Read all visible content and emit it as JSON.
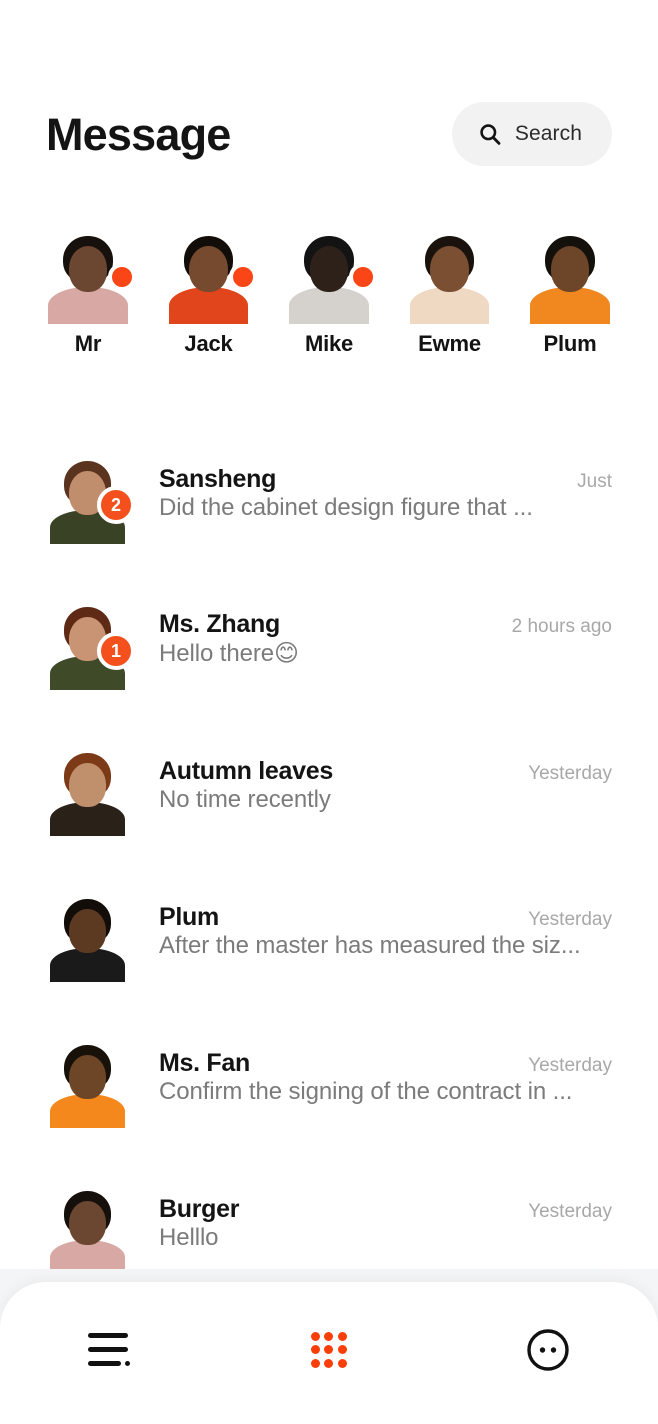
{
  "header": {
    "title": "Message",
    "search_label": "Search",
    "search_icon": "search-icon"
  },
  "colors": {
    "accent": "#fa4616",
    "badge": "#f4501e",
    "grid_icon": "#f93e08",
    "title": "#141414",
    "preview": "#7b7b7b",
    "time": "#a8a8a8",
    "search_bg": "#f2f2f2",
    "background": "#ffffff"
  },
  "stories": [
    {
      "name": "Mr",
      "online": true,
      "bg": "#1d6b70",
      "hair": "#17110d",
      "skin": "#6b4630",
      "body": "#d8a9a4"
    },
    {
      "name": "Jack",
      "online": true,
      "bg": "#c8651d",
      "hair": "#120d09",
      "skin": "#764a2e",
      "body": "#e0451c"
    },
    {
      "name": "Mike",
      "online": true,
      "bg": "#b9b9b9",
      "hair": "#131313",
      "skin": "#2e2119",
      "body": "#d5d2cd"
    },
    {
      "name": "Ewme",
      "online": false,
      "bg": "#9fc2b4",
      "hair": "#1a130d",
      "skin": "#7a4f32",
      "body": "#efd9c2"
    },
    {
      "name": "Plum",
      "online": false,
      "bg": "#2b4a63",
      "hair": "#14100c",
      "skin": "#6d4529",
      "body": "#f0871f"
    }
  ],
  "messages": [
    {
      "name": "Sansheng",
      "preview": "Did the cabinet design figure that ...",
      "time": "Just",
      "badge": "2",
      "bg": "#c8a48c",
      "hair": "#5b3420",
      "skin": "#c08e6d",
      "body": "#3a4226"
    },
    {
      "name": "Ms. Zhang",
      "preview": "Hello there😊",
      "time": "2 hours ago",
      "badge": "1",
      "bg": "#ccd5de",
      "hair": "#5e2a16",
      "skin": "#c99473",
      "body": "#3e4a28"
    },
    {
      "name": "Autumn leaves",
      "preview": "No time recently",
      "time": "Yesterday",
      "badge": "",
      "bg": "#3b332c",
      "hair": "#7d3a16",
      "skin": "#c08f6c",
      "body": "#2a2119"
    },
    {
      "name": "Plum",
      "preview": "After the master has measured the siz...",
      "time": "Yesterday",
      "badge": "",
      "bg": "#f3e8dc",
      "hair": "#120d09",
      "skin": "#5c3a22",
      "body": "#1a1a1a"
    },
    {
      "name": "Ms. Fan",
      "preview": "Confirm the signing of the contract in ...",
      "time": "Yesterday",
      "badge": "",
      "bg": "#2c4a60",
      "hair": "#171109",
      "skin": "#6d4527",
      "body": "#f4881c"
    },
    {
      "name": "Burger",
      "preview": "Helllo",
      "time": "Yesterday",
      "badge": "",
      "bg": "#1d6b70",
      "hair": "#16100c",
      "skin": "#6b4630",
      "body": "#d8a9a4"
    }
  ],
  "bottom_nav": [
    {
      "icon": "list-icon",
      "active": false
    },
    {
      "icon": "grid-dots-icon",
      "active": true
    },
    {
      "icon": "face-circle-icon",
      "active": false
    }
  ]
}
